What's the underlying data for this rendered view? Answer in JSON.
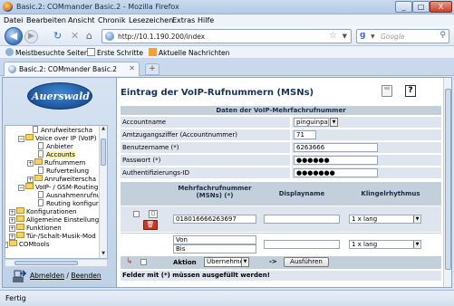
{
  "window": {
    "title": "Basic.2: COMmander Basic.2 - Mozilla Firefox",
    "controls": [
      "_",
      "□",
      "X"
    ]
  },
  "menubar": [
    "Datei",
    "Bearbeiten",
    "Ansicht",
    "Chronik",
    "Lesezeichen",
    "Extras",
    "Hilfe"
  ],
  "navbar": {
    "url": "http://10.1.190.200/index",
    "search_placeholder": "Google"
  },
  "bookmarks": [
    "Meistbesuchte Seiten",
    "Erste Schritte",
    "Aktuelle Nachrichten"
  ],
  "tab": {
    "label": "Basic.2: COMmander Basic.2",
    "new_tab": "+"
  },
  "sidebar": {
    "logo": "Auerswald",
    "tree": [
      {
        "label": "Anrufweiterscha",
        "type": "doc"
      },
      {
        "label": "Voice over IP (VoIP)",
        "type": "folder-open"
      },
      {
        "label": "Anbieter",
        "type": "doc"
      },
      {
        "label": "Accounts",
        "type": "doc",
        "selected": true
      },
      {
        "label": "Rufnummern",
        "type": "folder"
      },
      {
        "label": "Rufverteilung",
        "type": "doc"
      },
      {
        "label": "Anrufweiterscha",
        "type": "folder"
      },
      {
        "label": "VoIP- / GSM-Routing",
        "type": "folder-open"
      },
      {
        "label": "Ausnahmenrufnu",
        "type": "doc"
      },
      {
        "label": "Routing konfigur",
        "type": "doc"
      },
      {
        "label": "Konfigurationen",
        "type": "folder"
      },
      {
        "label": "Allgemeine Einstellung",
        "type": "folder"
      },
      {
        "label": "Funktionen",
        "type": "folder"
      },
      {
        "label": "Tür-/Schalt-Musik-Mod",
        "type": "folder"
      },
      {
        "label": "COMtools",
        "type": "folder"
      }
    ],
    "logout": {
      "link1": "Abmelden",
      "sep": " / ",
      "link2": "Beenden"
    }
  },
  "main": {
    "title": "Eintrag der VoIP-Rufnummern (MSNs)",
    "section_title": "Daten der VoIP-Mehrfachrufnummer",
    "fields": [
      {
        "label": "Accountname",
        "value": "pinguinpark",
        "kind": "select"
      },
      {
        "label": "Amtzugangsziffer (Accountnummer)",
        "value": "71",
        "kind": "input"
      },
      {
        "label": "Benutzername (*)",
        "value": "6263666",
        "kind": "input"
      },
      {
        "label": "Passwort (*)",
        "value": "●●●●●●",
        "kind": "input"
      },
      {
        "label": "Authentifizierungs-ID",
        "value": "●●●●●●●",
        "kind": "input"
      }
    ],
    "msn_table": {
      "col_msn": "Mehrfachrufnummer (MSNs) (*)",
      "col_display": "Displayname",
      "col_ring": "Klingelrhythmus",
      "rows": [
        {
          "msn": "018016666263697",
          "display": "",
          "ring": "1 x lang"
        }
      ],
      "range_row": {
        "from_label": "Von",
        "to_label": "Bis",
        "ring": "1 x lang"
      }
    },
    "action": {
      "label": "Aktion",
      "select": "Übernehmen",
      "arrow": "->",
      "button": "Ausführen"
    },
    "required_note": "Felder mit (*) müssen ausgefüllt werden!"
  },
  "status": "Fertig",
  "colors": {
    "accent": "#16325c",
    "header_bg": "#c4cfdc",
    "row_bg": "#dee5ee",
    "delete": "#c83a25"
  }
}
